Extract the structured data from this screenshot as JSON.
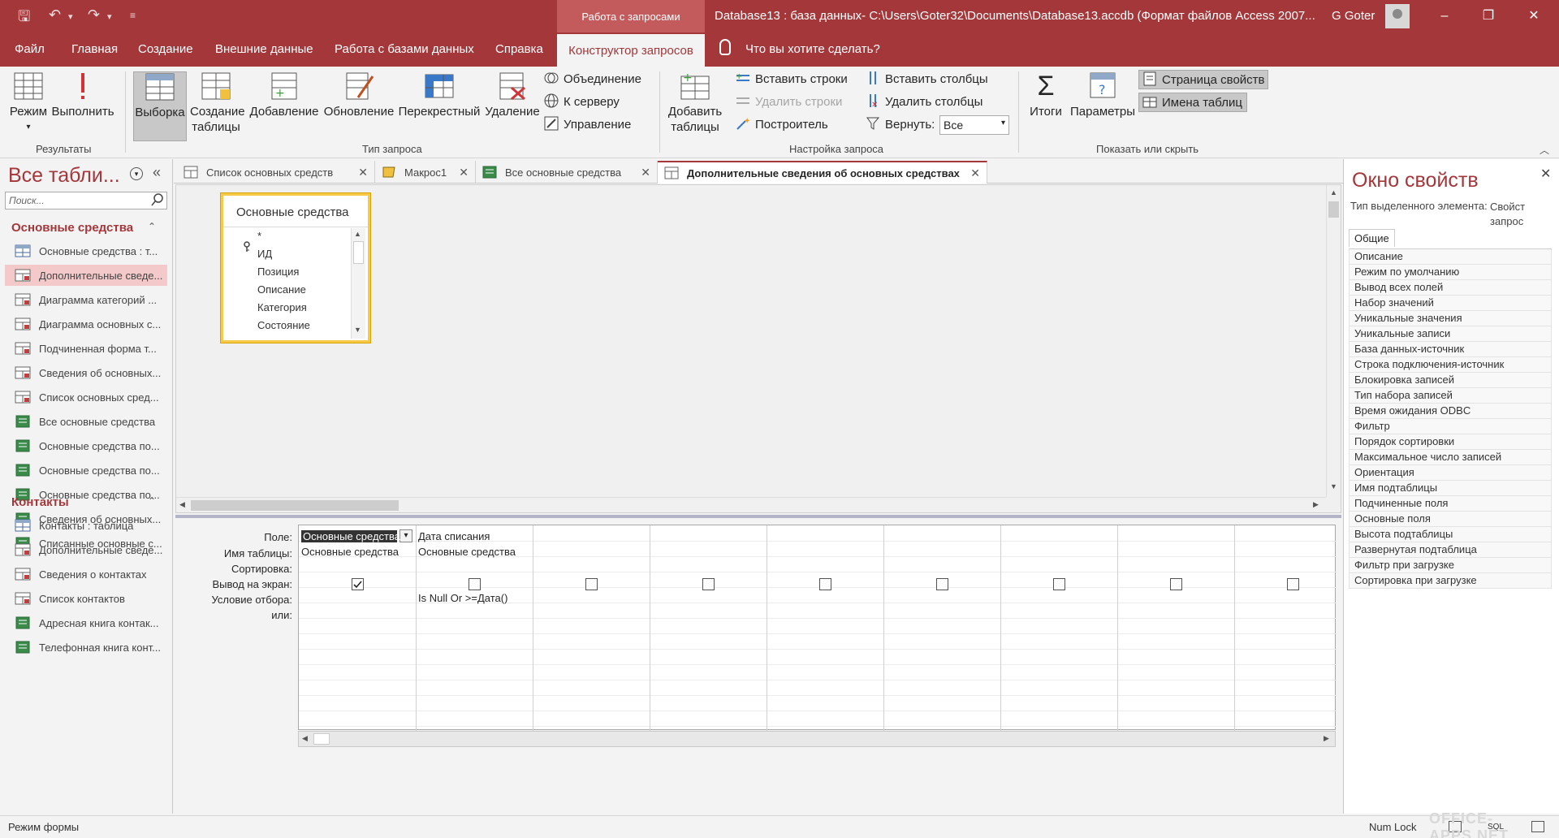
{
  "window": {
    "context_tab_label": "Работа с запросами",
    "title": "Database13 : база данных- C:\\Users\\Goter32\\Documents\\Database13.accdb (Формат файлов Access 2007...",
    "user": "G Goter",
    "minimize": "–",
    "restore": "❐",
    "close": "✕"
  },
  "menu": {
    "tabs": [
      "Файл",
      "Главная",
      "Создание",
      "Внешние данные",
      "Работа с базами данных",
      "Справка"
    ],
    "active_tab": "Конструктор запросов",
    "tell_me": "Что вы хотите сделать?"
  },
  "ribbon": {
    "results": {
      "label": "Результаты",
      "view": "Режим",
      "run": "Выполнить"
    },
    "query_type": {
      "label": "Тип запроса",
      "select": "Выборка",
      "make_table": [
        "Создание",
        "таблицы"
      ],
      "append": "Добавление",
      "update": "Обновление",
      "crosstab": "Перекрестный",
      "delete": "Удаление",
      "union": "Объединение",
      "pass_through": "К серверу",
      "data_definition": "Управление"
    },
    "query_setup": {
      "label": "Настройка запроса",
      "show_table": [
        "Добавить",
        "таблицы"
      ],
      "insert_rows": "Вставить строки",
      "delete_rows": "Удалить строки",
      "builder": "Построитель",
      "insert_columns": "Вставить столбцы",
      "delete_columns": "Удалить столбцы",
      "return_label": "Вернуть:",
      "return_value": "Все"
    },
    "show_hide": {
      "label": "Показать или скрыть",
      "totals": "Итоги",
      "parameters": "Параметры",
      "property_sheet": "Страница свойств",
      "table_names": "Имена таблиц"
    }
  },
  "nav": {
    "title": "Все табли...",
    "search_placeholder": "Поиск...",
    "groups": [
      {
        "name": "Основные средства",
        "items": [
          {
            "label": "Основные средства : т...",
            "kind": "table"
          },
          {
            "label": "Дополнительные сведе...",
            "kind": "query",
            "selected": true
          },
          {
            "label": "Диаграмма категорий ...",
            "kind": "query"
          },
          {
            "label": "Диаграмма основных с...",
            "kind": "query"
          },
          {
            "label": "Подчиненная форма т...",
            "kind": "query"
          },
          {
            "label": "Сведения об основных...",
            "kind": "query"
          },
          {
            "label": "Список основных сред...",
            "kind": "query"
          },
          {
            "label": "Все основные средства",
            "kind": "report"
          },
          {
            "label": "Основные средства по...",
            "kind": "report"
          },
          {
            "label": "Основные средства по...",
            "kind": "report"
          },
          {
            "label": "Основные средства по...",
            "kind": "report"
          },
          {
            "label": "Сведения об основных...",
            "kind": "report"
          },
          {
            "label": "Списанные основные с...",
            "kind": "report"
          }
        ]
      },
      {
        "name": "Контакты",
        "items": [
          {
            "label": "Контакты : таблица",
            "kind": "table"
          },
          {
            "label": "Дополнительные сведе...",
            "kind": "query"
          },
          {
            "label": "Сведения о контактах",
            "kind": "query"
          },
          {
            "label": "Список контактов",
            "kind": "query"
          },
          {
            "label": "Адресная книга контак...",
            "kind": "report"
          },
          {
            "label": "Телефонная книга конт...",
            "kind": "report"
          }
        ]
      }
    ]
  },
  "doc_tabs": [
    {
      "label": "Список основных средств",
      "kind": "query"
    },
    {
      "label": "Макрос1",
      "kind": "macro"
    },
    {
      "label": "Все основные средства",
      "kind": "report"
    },
    {
      "label": "Дополнительные сведения об основных средствах",
      "kind": "query",
      "active": true
    }
  ],
  "field_list": {
    "title": "Основные средства",
    "fields": [
      "*",
      "ИД",
      "Позиция",
      "Описание",
      "Категория",
      "Состояние"
    ]
  },
  "design_grid": {
    "row_labels": [
      "Поле:",
      "Имя таблицы:",
      "Сортировка:",
      "Вывод на экран:",
      "Условие отбора:",
      "или:"
    ],
    "columns": [
      {
        "field": "Основные средства",
        "table": "Основные средства",
        "sort": "",
        "show": true,
        "criteria": ""
      },
      {
        "field": "Дата списания",
        "table": "Основные средства",
        "sort": "",
        "show": false,
        "criteria": "Is Null Or >=Дата()"
      },
      {
        "field": "",
        "table": "",
        "sort": "",
        "show": false,
        "criteria": ""
      },
      {
        "field": "",
        "table": "",
        "sort": "",
        "show": false,
        "criteria": ""
      },
      {
        "field": "",
        "table": "",
        "sort": "",
        "show": false,
        "criteria": ""
      },
      {
        "field": "",
        "table": "",
        "sort": "",
        "show": false,
        "criteria": ""
      },
      {
        "field": "",
        "table": "",
        "sort": "",
        "show": false,
        "criteria": ""
      },
      {
        "field": "",
        "table": "",
        "sort": "",
        "show": false,
        "criteria": ""
      },
      {
        "field": "",
        "table": "",
        "sort": "",
        "show": false,
        "criteria": ""
      }
    ]
  },
  "property_sheet": {
    "title": "Окно свойств",
    "selection_type_label": "Тип выделенного элемента:",
    "selection_type_value": "Свойст запрос",
    "tab": "Общие",
    "properties": [
      "Описание",
      "Режим по умолчанию",
      "Вывод всех полей",
      "Набор значений",
      "Уникальные значения",
      "Уникальные записи",
      "База данных-источник",
      "Строка подключения-источник",
      "Блокировка записей",
      "Тип набора записей",
      "Время ожидания ODBC",
      "Фильтр",
      "Порядок сортировки",
      "Максимальное число записей",
      "Ориентация",
      "Имя подтаблицы",
      "Подчиненные поля",
      "Основные поля",
      "Высота подтаблицы",
      "Развернутая подтаблица",
      "Фильтр при загрузке",
      "Сортировка при загрузке"
    ]
  },
  "status": {
    "left": "Режим формы",
    "numlock": "Num Lock",
    "sql": "SQL",
    "watermark": "OFFICE-APPS.NET"
  },
  "colors": {
    "brand": "#a4373a",
    "selection": "#f4c9c9",
    "field_list_border": "#f7c948"
  }
}
